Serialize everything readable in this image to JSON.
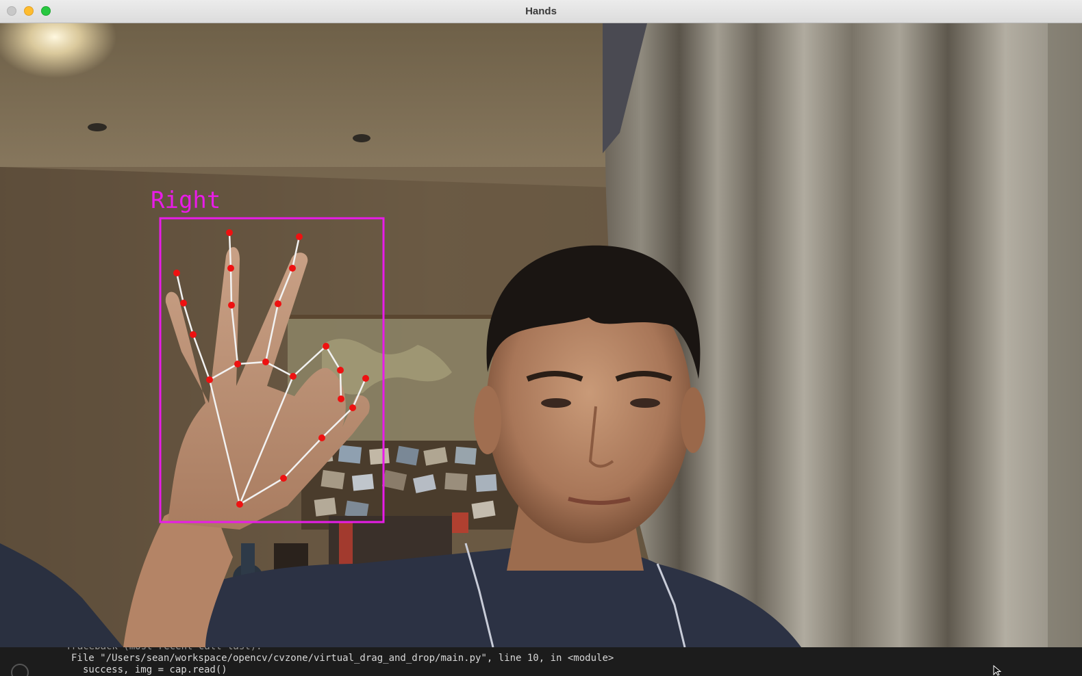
{
  "window": {
    "title": "Hands"
  },
  "overlay": {
    "hand_label": "Right",
    "color": "#e81ce8",
    "landmark_color": "#ee1111",
    "skeleton_color": "#f2f2f2"
  },
  "terminal": {
    "lines": [
      "Traceback (most recent call last):",
      "File \"/Users/sean/workspace/opencv/cvzone/virtual_drag_and_drop/main.py\", line 10, in <module>",
      "success, img = cap.read()"
    ]
  },
  "icons": {
    "close": "close-button-icon",
    "minimize": "minimize-button-icon",
    "maximize": "maximize-button-icon",
    "cursor": "mouse-pointer-icon"
  }
}
